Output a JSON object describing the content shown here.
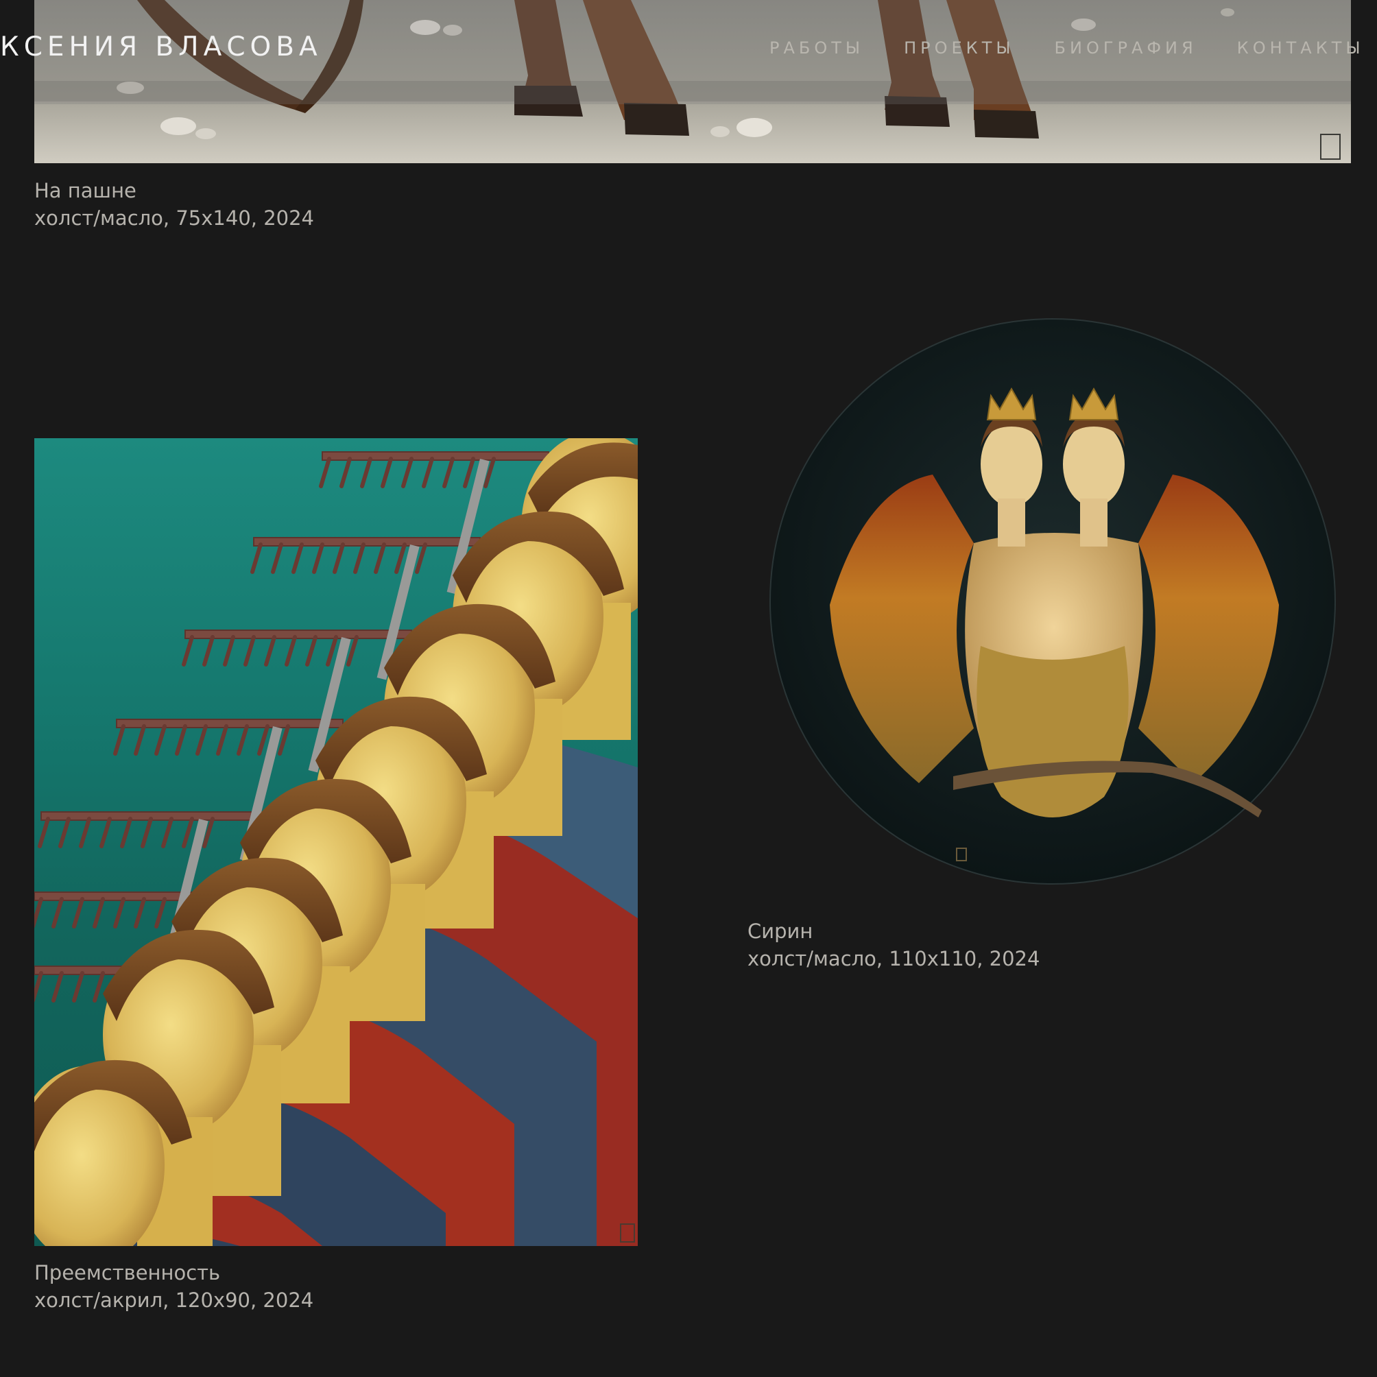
{
  "header": {
    "title": "КСЕНИЯ ВЛАСОВА",
    "nav": [
      {
        "label": "РАБОТЫ"
      },
      {
        "label": "ПРОЕКТЫ"
      },
      {
        "label": "БИОГРАФИЯ"
      },
      {
        "label": "КОНТАКТЫ"
      }
    ]
  },
  "artworks": [
    {
      "title": "На пашне",
      "details": "холст/масло, 75х140, 2024"
    },
    {
      "title": "Преемственность",
      "details": "холст/акрил, 120х90, 2024"
    },
    {
      "title": "Сирин",
      "details": "холст/масло, 110х110, 2024"
    }
  ],
  "colors": {
    "background": "#191919",
    "caption_text": "#b6b3ad",
    "title_text": "#f2f2f2",
    "nav_text": "#b9b6ae"
  }
}
